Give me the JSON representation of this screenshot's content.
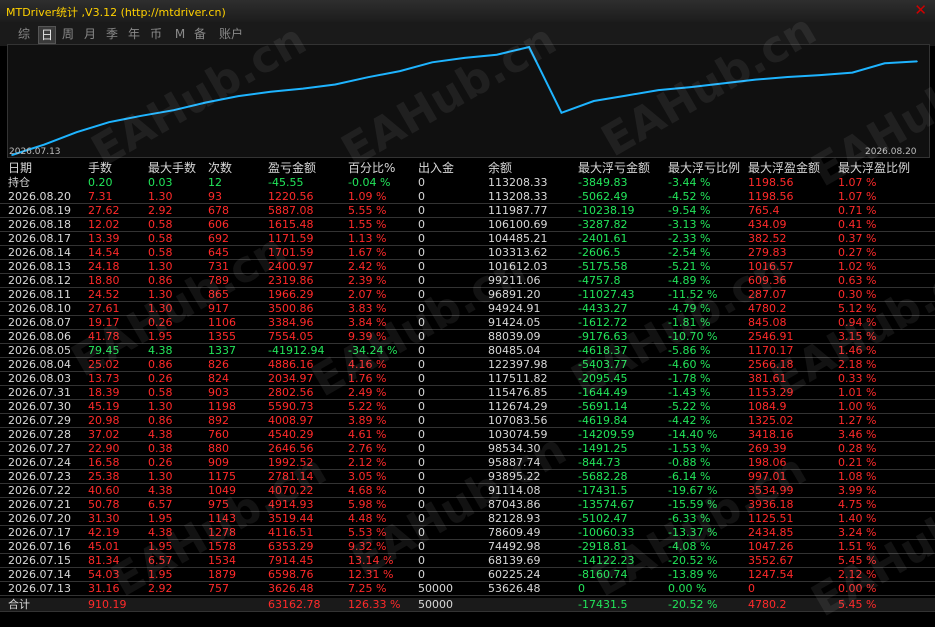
{
  "window": {
    "title": "MTDriver统计 ,V3.12 (http://mtdriver.cn)",
    "close_label": "✕"
  },
  "tabs": [
    {
      "label": "综",
      "active": false
    },
    {
      "label": "日",
      "active": true
    },
    {
      "label": "周",
      "active": false
    },
    {
      "label": "月",
      "active": false
    },
    {
      "label": "季",
      "active": false
    },
    {
      "label": "年",
      "active": false
    },
    {
      "label": "币",
      "active": false
    },
    {
      "label": "M",
      "active": false
    },
    {
      "label": "备",
      "active": false
    },
    {
      "label": "账户",
      "active": false
    }
  ],
  "watermark": "EAHub.cn",
  "colors": {
    "profit": "#ff2a2a",
    "loss": "#22e55a",
    "neutral": "#d8d8d8",
    "line": "#1eb4ff"
  },
  "chart_data": {
    "type": "line",
    "x_start_label": "2026.07.13",
    "x_end_label": "2026.08.20",
    "x": [
      "2026.07.13",
      "2026.07.14",
      "2026.07.15",
      "2026.07.16",
      "2026.07.17",
      "2026.07.20",
      "2026.07.21",
      "2026.07.22",
      "2026.07.23",
      "2026.07.24",
      "2026.07.27",
      "2026.07.28",
      "2026.07.29",
      "2026.07.30",
      "2026.07.31",
      "2026.08.03",
      "2026.08.04",
      "2026.08.05",
      "2026.08.06",
      "2026.08.07",
      "2026.08.10",
      "2026.08.11",
      "2026.08.12",
      "2026.08.13",
      "2026.08.14",
      "2026.08.17",
      "2026.08.18",
      "2026.08.19",
      "2026.08.20"
    ],
    "series": [
      {
        "values": [
          53626.48,
          60225.24,
          68139.69,
          74492.98,
          78609.49,
          82128.93,
          87043.86,
          91114.08,
          93895.22,
          95887.74,
          98534.3,
          103074.59,
          107083.56,
          112674.29,
          115476.85,
          117511.82,
          122397.98,
          80485.04,
          88039.09,
          91424.05,
          94924.91,
          96891.2,
          99211.06,
          101612.03,
          103313.62,
          104485.21,
          106100.69,
          111987.77,
          113208.33
        ]
      }
    ]
  },
  "table": {
    "headers": [
      "日期",
      "手数",
      "最大手数",
      "次数",
      "盈亏金额",
      "百分比%",
      "出入金",
      "余额",
      "最大浮亏金额",
      "最大浮亏比例",
      "最大浮盈金额",
      "最大浮盈比例"
    ],
    "holding": [
      "持仓",
      "0.20",
      "0.03",
      "12",
      "-45.55",
      "-0.04 %",
      "0",
      "113208.33",
      "-3849.83",
      "-3.44 %",
      "1198.56",
      "1.07 %"
    ],
    "rows": [
      [
        "2026.08.20",
        "7.31",
        "1.30",
        "93",
        "1220.56",
        "1.09 %",
        "0",
        "113208.33",
        "-5062.49",
        "-4.52 %",
        "1198.56",
        "1.07 %"
      ],
      [
        "2026.08.19",
        "27.62",
        "2.92",
        "678",
        "5887.08",
        "5.55 %",
        "0",
        "111987.77",
        "-10238.19",
        "-9.54 %",
        "765.4",
        "0.71 %"
      ],
      [
        "2026.08.18",
        "12.02",
        "0.58",
        "606",
        "1615.48",
        "1.55 %",
        "0",
        "106100.69",
        "-3287.82",
        "-3.13 %",
        "434.09",
        "0.41 %"
      ],
      [
        "2026.08.17",
        "13.39",
        "0.58",
        "692",
        "1171.59",
        "1.13 %",
        "0",
        "104485.21",
        "-2401.61",
        "-2.33 %",
        "382.52",
        "0.37 %"
      ],
      [
        "2026.08.14",
        "14.54",
        "0.58",
        "645",
        "1701.59",
        "1.67 %",
        "0",
        "103313.62",
        "-2606.5",
        "-2.54 %",
        "279.83",
        "0.27 %"
      ],
      [
        "2026.08.13",
        "24.18",
        "1.30",
        "731",
        "2400.97",
        "2.42 %",
        "0",
        "101612.03",
        "-5175.58",
        "-5.21 %",
        "1016.57",
        "1.02 %"
      ],
      [
        "2026.08.12",
        "18.80",
        "0.86",
        "789",
        "2319.86",
        "2.39 %",
        "0",
        "99211.06",
        "-4757.8",
        "-4.89 %",
        "609.36",
        "0.63 %"
      ],
      [
        "2026.08.11",
        "24.52",
        "1.30",
        "865",
        "1966.29",
        "2.07 %",
        "0",
        "96891.20",
        "-11027.43",
        "-11.52 %",
        "287.07",
        "0.30 %"
      ],
      [
        "2026.08.10",
        "27.61",
        "1.30",
        "917",
        "3500.86",
        "3.83 %",
        "0",
        "94924.91",
        "-4433.27",
        "-4.79 %",
        "4780.2",
        "5.12 %"
      ],
      [
        "2026.08.07",
        "19.17",
        "0.26",
        "1106",
        "3384.96",
        "3.84 %",
        "0",
        "91424.05",
        "-1612.72",
        "-1.81 %",
        "845.08",
        "0.94 %"
      ],
      [
        "2026.08.06",
        "41.78",
        "1.95",
        "1355",
        "7554.05",
        "9.39 %",
        "0",
        "88039.09",
        "-9176.63",
        "-10.70 %",
        "2546.91",
        "3.15 %"
      ],
      [
        "2026.08.05",
        "79.45",
        "4.38",
        "1337",
        "-41912.94",
        "-34.24 %",
        "0",
        "80485.04",
        "-4618.37",
        "-5.86 %",
        "1170.17",
        "1.46 %"
      ],
      [
        "2026.08.04",
        "25.02",
        "0.86",
        "826",
        "4886.16",
        "4.16 %",
        "0",
        "122397.98",
        "-5403.77",
        "-4.60 %",
        "2566.18",
        "2.18 %"
      ],
      [
        "2026.08.03",
        "13.73",
        "0.26",
        "824",
        "2034.97",
        "1.76 %",
        "0",
        "117511.82",
        "-2095.45",
        "-1.78 %",
        "381.61",
        "0.33 %"
      ],
      [
        "2026.07.31",
        "18.39",
        "0.58",
        "903",
        "2802.56",
        "2.49 %",
        "0",
        "115476.85",
        "-1644.49",
        "-1.43 %",
        "1153.29",
        "1.01 %"
      ],
      [
        "2026.07.30",
        "45.19",
        "1.30",
        "1198",
        "5590.73",
        "5.22 %",
        "0",
        "112674.29",
        "-5691.14",
        "-5.22 %",
        "1084.9",
        "1.00 %"
      ],
      [
        "2026.07.29",
        "20.98",
        "0.86",
        "892",
        "4008.97",
        "3.89 %",
        "0",
        "107083.56",
        "-4619.84",
        "-4.42 %",
        "1325.02",
        "1.27 %"
      ],
      [
        "2026.07.28",
        "37.02",
        "4.38",
        "760",
        "4540.29",
        "4.61 %",
        "0",
        "103074.59",
        "-14209.59",
        "-14.40 %",
        "3418.16",
        "3.46 %"
      ],
      [
        "2026.07.27",
        "22.90",
        "0.38",
        "880",
        "2646.56",
        "2.76 %",
        "0",
        "98534.30",
        "-1491.25",
        "-1.53 %",
        "269.39",
        "0.28 %"
      ],
      [
        "2026.07.24",
        "16.58",
        "0.26",
        "909",
        "1992.52",
        "2.12 %",
        "0",
        "95887.74",
        "-844.73",
        "-0.88 %",
        "198.06",
        "0.21 %"
      ],
      [
        "2026.07.23",
        "25.38",
        "1.30",
        "1175",
        "2781.14",
        "3.05 %",
        "0",
        "93895.22",
        "-5682.28",
        "-6.14 %",
        "997.01",
        "1.08 %"
      ],
      [
        "2026.07.22",
        "40.60",
        "4.38",
        "1049",
        "4070.22",
        "4.68 %",
        "0",
        "91114.08",
        "-17431.5",
        "-19.67 %",
        "3534.99",
        "3.99 %"
      ],
      [
        "2026.07.21",
        "50.78",
        "6.57",
        "975",
        "4914.93",
        "5.98 %",
        "0",
        "87043.86",
        "-13574.67",
        "-15.59 %",
        "3936.18",
        "4.75 %"
      ],
      [
        "2026.07.20",
        "31.30",
        "1.95",
        "1143",
        "3519.44",
        "4.48 %",
        "0",
        "82128.93",
        "-5102.47",
        "-6.33 %",
        "1125.51",
        "1.40 %"
      ],
      [
        "2026.07.17",
        "42.19",
        "4.38",
        "1278",
        "4116.51",
        "5.53 %",
        "0",
        "78609.49",
        "-10060.33",
        "-13.37 %",
        "2434.85",
        "3.24 %"
      ],
      [
        "2026.07.16",
        "45.01",
        "1.95",
        "1578",
        "6353.29",
        "9.32 %",
        "0",
        "74492.98",
        "-2918.81",
        "-4.08 %",
        "1047.26",
        "1.51 %"
      ],
      [
        "2026.07.15",
        "81.34",
        "6.57",
        "1534",
        "7914.45",
        "13.14 %",
        "0",
        "68139.69",
        "-14122.23",
        "-20.52 %",
        "3552.67",
        "5.45 %"
      ],
      [
        "2026.07.14",
        "54.03",
        "1.95",
        "1879",
        "6598.76",
        "12.31 %",
        "0",
        "60225.24",
        "-8160.74",
        "-13.89 %",
        "1247.54",
        "2.12 %"
      ],
      [
        "2026.07.13",
        "31.16",
        "2.92",
        "757",
        "3626.48",
        "7.25 %",
        "50000",
        "53626.48",
        "0",
        "0.00 %",
        "0",
        "0.00 %"
      ]
    ],
    "total": [
      "合计",
      "910.19",
      "",
      "",
      "63162.78",
      "126.33 %",
      "50000",
      "",
      "-17431.5",
      "-20.52 %",
      "4780.2",
      "5.45 %"
    ]
  }
}
